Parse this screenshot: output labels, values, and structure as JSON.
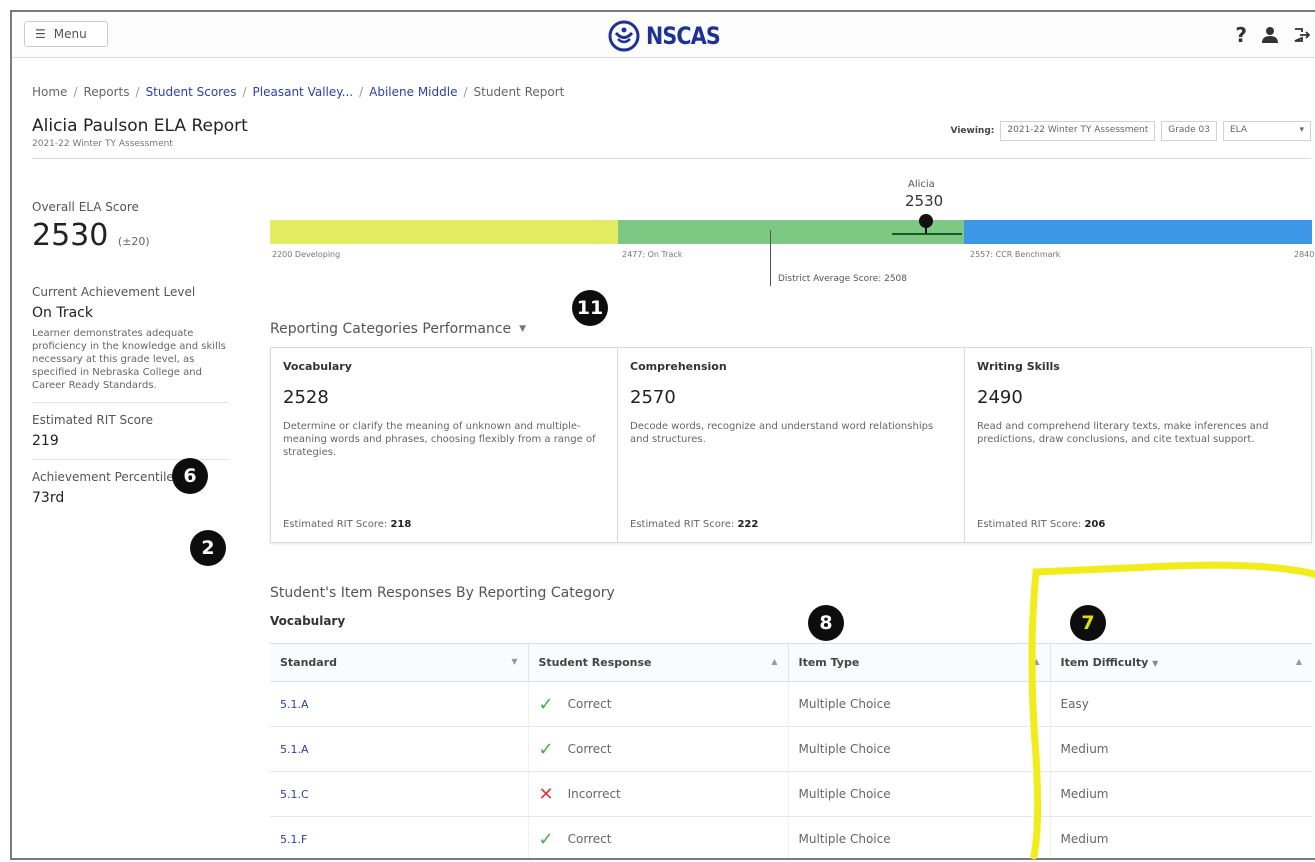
{
  "header": {
    "menu_label": "Menu",
    "logo_text": "NSCAS",
    "brand_color": "#1d3296"
  },
  "breadcrumb": [
    {
      "label": "Home",
      "link": false
    },
    {
      "label": "Reports",
      "link": false
    },
    {
      "label": "Student Scores",
      "link": true
    },
    {
      "label": "Pleasant Valley...",
      "link": true
    },
    {
      "label": "Abilene Middle",
      "link": true
    },
    {
      "label": "Student Report",
      "link": false
    }
  ],
  "report": {
    "title": "Alicia Paulson ELA Report",
    "subtitle": "2021-22 Winter TY Assessment"
  },
  "viewing": {
    "label": "Viewing:",
    "assessment": "2021-22 Winter TY Assessment",
    "grade": "Grade 03",
    "subject": "ELA"
  },
  "summary": {
    "overall_label": "Overall ELA Score",
    "overall_score": "2530",
    "overall_sem": "(±20)",
    "level_label": "Current Achievement Level",
    "level_value": "On Track",
    "level_desc": "Learner demonstrates adequate proficiency in the knowledge and skills necessary at this grade level, as specified in Nebraska College and Career Ready Standards.",
    "rit_label": "Estimated RIT Score",
    "rit_value": "219",
    "percentile_label": "Achievement Percentile",
    "percentile_value": "73rd"
  },
  "scale": {
    "student_name": "Alicia",
    "student_score": "2530",
    "ticks": {
      "t1": "2200 Developing",
      "t2": "2477: On Track",
      "t3": "2557: CCR Benchmark",
      "t4": "2840"
    },
    "district_label": "District Average Score: 2508",
    "colors": {
      "developing": "#e4ec62",
      "on_track": "#7dc883",
      "ccr": "#3c97e6"
    }
  },
  "callouts": {
    "c11": "11",
    "c6": "6",
    "c2": "2",
    "c8": "8",
    "c7": "7"
  },
  "categories": {
    "title": "Reporting Categories Performance",
    "cards": [
      {
        "name": "Vocabulary",
        "score": "2528",
        "desc": "Determine or clarify the meaning of unknown and multiple-meaning words and phrases, choosing flexibly from a range of strategies.",
        "rit_label": "Estimated RIT Score:",
        "rit": "218"
      },
      {
        "name": "Comprehension",
        "score": "2570",
        "desc": "Decode words, recognize and understand word relationships and structures.",
        "rit_label": "Estimated RIT Score:",
        "rit": "222"
      },
      {
        "name": "Writing Skills",
        "score": "2490",
        "desc": "Read and comprehend literary texts, make inferences and predictions, draw conclusions, and cite textual support.",
        "rit_label": "Estimated RIT Score:",
        "rit": "206"
      }
    ]
  },
  "items": {
    "title": "Student's Item Responses By Reporting Category",
    "category": "Vocabulary",
    "columns": [
      "Standard",
      "Student Response",
      "Item Type",
      "Item Difficulty"
    ],
    "rows": [
      {
        "standard": "5.1.A",
        "response": "Correct",
        "correct": true,
        "type": "Multiple Choice",
        "difficulty": "Easy"
      },
      {
        "standard": "5.1.A",
        "response": "Correct",
        "correct": true,
        "type": "Multiple Choice",
        "difficulty": "Medium"
      },
      {
        "standard": "5.1.C",
        "response": "Incorrect",
        "correct": false,
        "type": "Multiple Choice",
        "difficulty": "Medium"
      },
      {
        "standard": "5.1.F",
        "response": "Correct",
        "correct": true,
        "type": "Multiple Choice",
        "difficulty": "Medium"
      }
    ]
  },
  "icons": {
    "help": "help-icon",
    "user": "user-icon",
    "logout": "logout-icon",
    "correct": "check-icon",
    "incorrect": "x-icon"
  },
  "highlight_color": "#f2ec1a"
}
